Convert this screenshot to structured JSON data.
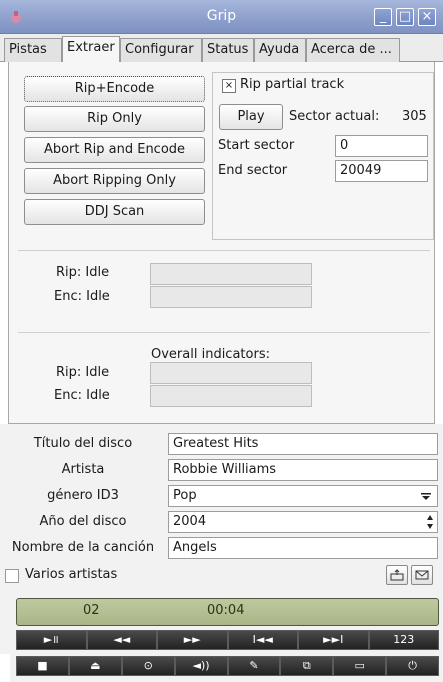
{
  "window": {
    "title": "Grip",
    "controls": [
      "_",
      "□",
      "×"
    ]
  },
  "tabs": [
    "Pistas",
    "Extraer",
    "Configurar",
    "Status",
    "Ayuda",
    "Acerca de ..."
  ],
  "actions": {
    "rip_encode": "Rip+Encode",
    "rip_only": "Rip Only",
    "abort_rip_encode": "Abort Rip and Encode",
    "abort_ripping": "Abort Ripping Only",
    "ddj_scan": "DDJ Scan"
  },
  "partial": {
    "checkbox_label": "Rip partial track",
    "checked_mark": "×",
    "play": "Play",
    "sector_actual_label": "Sector actual:",
    "sector_actual_value": "305",
    "start_label": "Start sector",
    "start_value": "0",
    "end_label": "End sector",
    "end_value": "20049"
  },
  "status": {
    "rip": "Rip: Idle",
    "enc": "Enc: Idle",
    "overall_title": "Overall indicators:",
    "overall_rip": "Rip: Idle",
    "overall_enc": "Enc: Idle"
  },
  "disc": {
    "titulo_label": "Título del disco",
    "titulo_value": "Greatest Hits",
    "artista_label": "Artista",
    "artista_value": "Robbie Williams",
    "genero_label": "género ID3",
    "genero_value": "Pop",
    "ano_label": "Año del disco",
    "ano_value": "2004",
    "cancion_label": "Nombre de la canción",
    "cancion_value": "Angels",
    "varios_label": "Varios artistas"
  },
  "player": {
    "track": "02",
    "time": "00:04",
    "row1": [
      "►॥",
      "◄◄",
      "►►",
      "I◄◄",
      "►►I",
      "123"
    ],
    "row2": [
      "■",
      "⏏",
      "⊙",
      "◄))",
      "✎",
      "⧉",
      "▭",
      "⏻"
    ]
  }
}
